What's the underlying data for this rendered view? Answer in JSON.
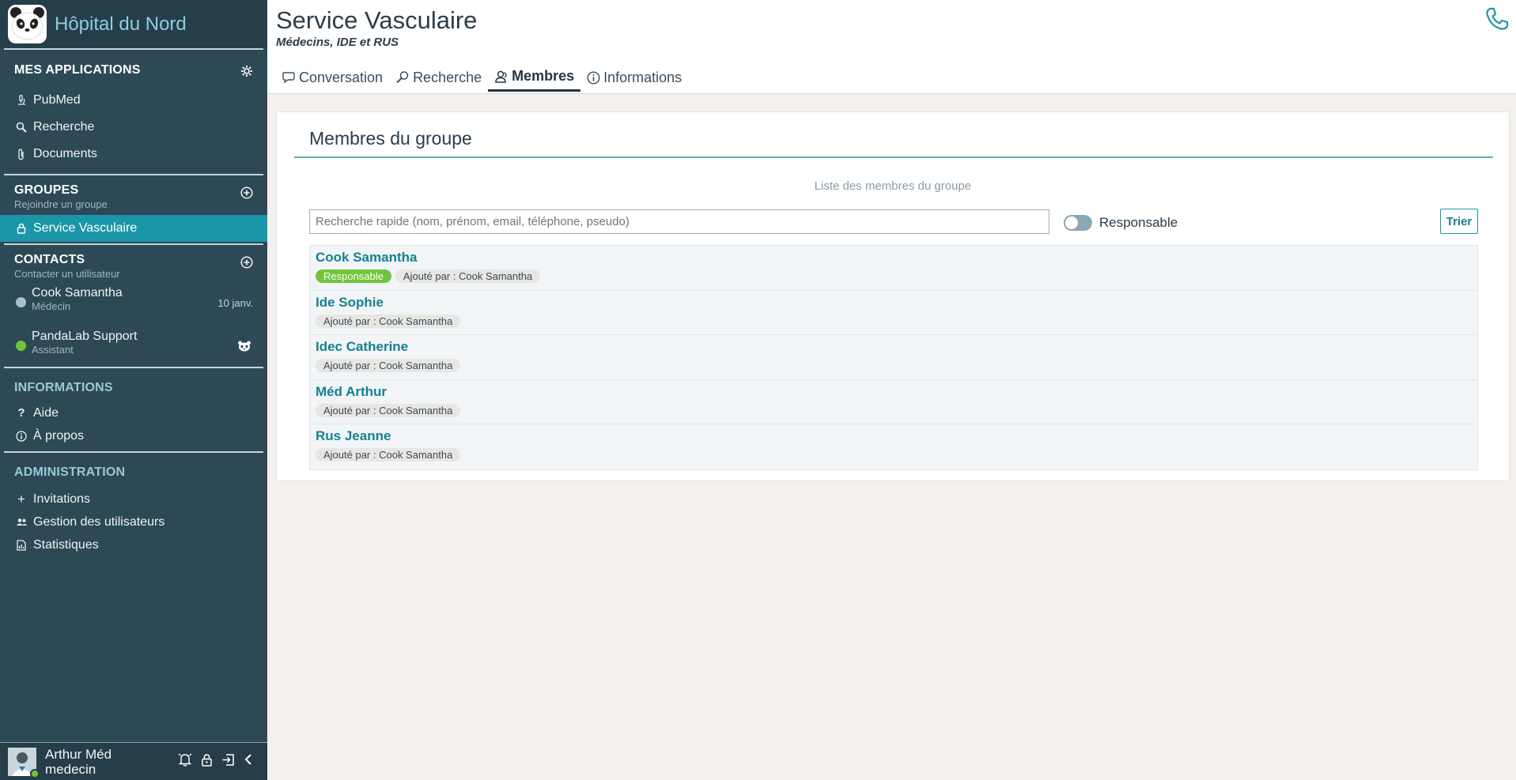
{
  "app": {
    "title": "Hôpital du Nord"
  },
  "sidebar": {
    "apps": {
      "title": "MES APPLICATIONS",
      "items": [
        {
          "label": "PubMed",
          "icon": "microscope-icon"
        },
        {
          "label": "Recherche",
          "icon": "search-icon"
        },
        {
          "label": "Documents",
          "icon": "paperclip-icon"
        }
      ]
    },
    "groups": {
      "title": "GROUPES",
      "subtitle": "Rejoindre un groupe",
      "items": [
        {
          "label": "Service Vasculaire",
          "icon": "lock-icon",
          "active": true
        }
      ]
    },
    "contacts": {
      "title": "CONTACTS",
      "subtitle": "Contacter un utilisateur",
      "items": [
        {
          "name": "Cook Samantha",
          "role": "Médecin",
          "date": "10 janv.",
          "status_color": "#a9c1cc"
        },
        {
          "name": "PandaLab Support",
          "role": "Assistant",
          "date": "",
          "status_color": "#72c43a"
        }
      ]
    },
    "info": {
      "title": "INFORMATIONS",
      "items": [
        {
          "label": "Aide",
          "icon": "question-icon"
        },
        {
          "label": "À propos",
          "icon": "info-icon"
        }
      ]
    },
    "admin": {
      "title": "ADMINISTRATION",
      "items": [
        {
          "label": "Invitations",
          "icon": "plus-icon"
        },
        {
          "label": "Gestion des utilisateurs",
          "icon": "users-icon"
        },
        {
          "label": "Statistiques",
          "icon": "report-icon"
        }
      ]
    },
    "user": {
      "name": "Arthur Méd",
      "role": "medecin"
    }
  },
  "header": {
    "title": "Service Vasculaire",
    "subtitle": "Médecins, IDE et RUS",
    "tabs": [
      {
        "label": "Conversation",
        "icon": "chat-icon",
        "active": false
      },
      {
        "label": "Recherche",
        "icon": "search-icon",
        "active": false
      },
      {
        "label": "Membres",
        "icon": "members-icon",
        "active": true
      },
      {
        "label": "Informations",
        "icon": "info-icon",
        "active": false
      }
    ]
  },
  "panel": {
    "title": "Membres du groupe",
    "caption": "Liste des membres du groupe",
    "search_placeholder": "Recherche rapide (nom, prénom, email, téléphone, pseudo)",
    "toggle_label": "Responsable",
    "sort_label": "Trier",
    "members": [
      {
        "name": "Cook Samantha",
        "responsable": "Responsable",
        "added_by": "Ajouté par : Cook Samantha"
      },
      {
        "name": "Ide Sophie",
        "added_by": "Ajouté par : Cook Samantha"
      },
      {
        "name": "Idec Catherine",
        "added_by": "Ajouté par : Cook Samantha"
      },
      {
        "name": "Méd Arthur",
        "added_by": "Ajouté par : Cook Samantha"
      },
      {
        "name": "Rus Jeanne",
        "added_by": "Ajouté par : Cook Samantha"
      }
    ]
  },
  "colors": {
    "sidebar": "#2d4956",
    "accent": "#1b96a9",
    "responsable": "#72c43a",
    "link": "#17808f"
  }
}
